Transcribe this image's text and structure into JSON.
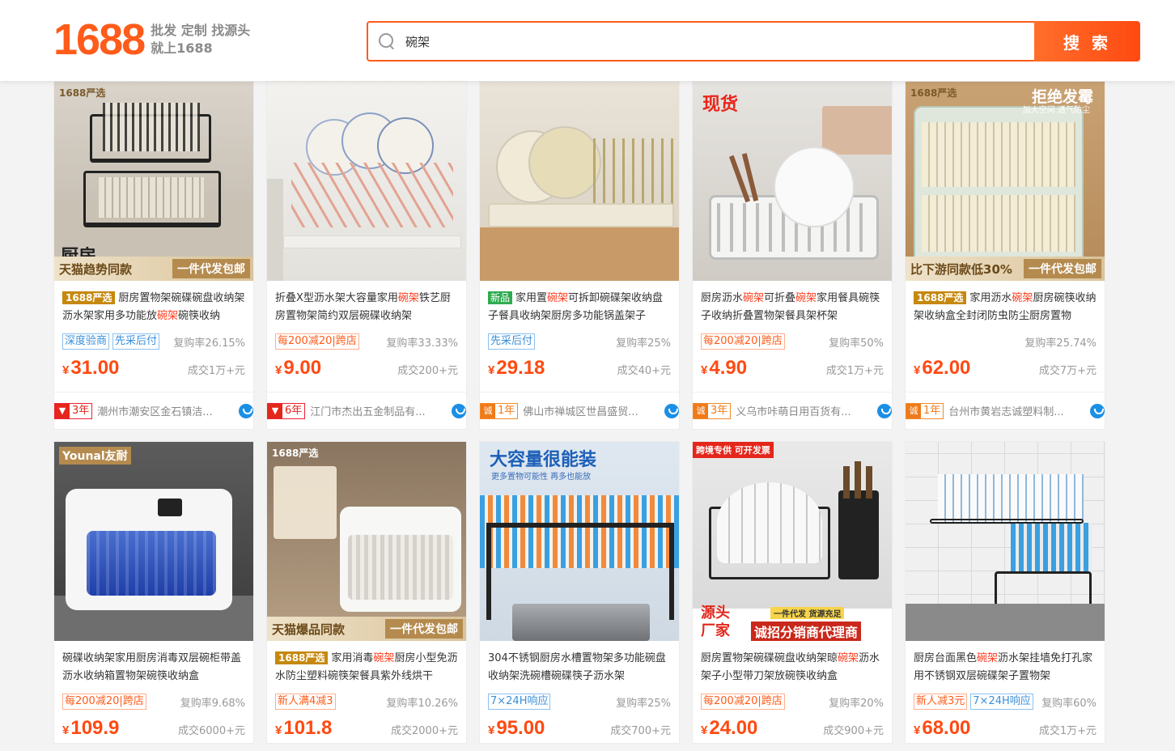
{
  "header": {
    "logo_text": "1688",
    "logo_tag_line1": "批发 定制 找源头",
    "logo_tag_line2": "就上1688",
    "search_value": "碗架",
    "search_button": "搜 索"
  },
  "colors": {
    "accent": "#ff5b1a",
    "price": "#ff4a12",
    "yanxuan": "#c6880e",
    "new": "#2eac50"
  },
  "products": [
    {
      "img": {
        "top_tag": "1688严选",
        "banner_left": "天猫趋势同款",
        "banner_right": "一件代发包邮"
      },
      "badge": "1688严选",
      "badge_type": "yx",
      "title_parts": [
        "厨房置物架碗碟碗盘收纳架沥水架家用多功能放",
        "碗架",
        "碗筷收纳"
      ],
      "tags": [
        {
          "text": "深度验商",
          "color": "blue"
        },
        {
          "text": "先采后付",
          "color": "blue"
        }
      ],
      "rebuy": "复购率26.15%",
      "price": "31.00",
      "deal": "成交1万+元",
      "shop_badge": "tm",
      "shop_years": "3年",
      "shop": "潮州市潮安区金石镇洁..."
    },
    {
      "img": {},
      "badge": "",
      "badge_type": "",
      "title_parts": [
        "折叠X型沥水架大容量家用",
        "碗架",
        "铁艺厨房置物架简约双层碗碟收纳架"
      ],
      "tags": [
        {
          "text": "每200减20|跨店",
          "color": "orange"
        }
      ],
      "rebuy": "复购率33.33%",
      "price": "9.00",
      "deal": "成交200+元",
      "shop_badge": "tm",
      "shop_years": "6年",
      "shop": "江门市杰出五金制品有..."
    },
    {
      "img": {},
      "badge": "新品",
      "badge_type": "new",
      "title_parts": [
        "家用置",
        "碗架",
        "可拆卸碗碟架收纳盘子餐具收纳架厨房多功能锅盖架子"
      ],
      "tags": [
        {
          "text": "先采后付",
          "color": "blue"
        }
      ],
      "rebuy": "复购率25%",
      "price": "29.18",
      "deal": "成交40+元",
      "shop_badge": "cx",
      "shop_years": "1年",
      "shop": "佛山市禅城区世昌盛贸..."
    },
    {
      "img": {
        "top_tag": "现货"
      },
      "badge": "",
      "badge_type": "",
      "title_parts": [
        "厨房沥水",
        "碗架",
        "可折叠",
        "碗架",
        "家用餐具碗筷子收纳折叠置物架餐具架杯架"
      ],
      "tags": [
        {
          "text": "每200减20|跨店",
          "color": "orange"
        }
      ],
      "rebuy": "复购率50%",
      "price": "4.90",
      "deal": "成交1万+元",
      "shop_badge": "cx",
      "shop_years": "3年",
      "shop": "义乌市咔萌日用百货有..."
    },
    {
      "img": {
        "top_tag": "1688严选",
        "top_right": "拒绝发霉",
        "top_right_sub": "加大空间 透气防尘",
        "banner_left": "比下游同款低30%",
        "banner_right": "一件代发包邮"
      },
      "badge": "1688严选",
      "badge_type": "yx",
      "title_parts": [
        "家用沥水",
        "碗架",
        "厨房碗筷收纳架收纳盒全封闭防虫防尘厨房置物"
      ],
      "tags": [],
      "rebuy": "复购率25.74%",
      "price": "62.00",
      "deal": "成交7万+元",
      "shop_badge": "cx",
      "shop_years": "1年",
      "shop": "台州市黄岩志诚塑料制..."
    },
    {
      "img": {
        "top_tag": "Younal友耐"
      },
      "badge": "",
      "badge_type": "",
      "title_parts": [
        "碗碟收纳架家用厨房消毒双层碗柜带盖沥水收纳箱置物架碗筷收纳盒"
      ],
      "tags": [
        {
          "text": "每200减20|跨店",
          "color": "orange"
        }
      ],
      "rebuy": "复购率9.68%",
      "price": "109.9",
      "deal": "成交6000+元"
    },
    {
      "img": {
        "top_tag": "1688严选",
        "banner_left": "天猫爆品同款",
        "banner_right": "一件代发包邮"
      },
      "badge": "1688严选",
      "badge_type": "yx",
      "title_parts": [
        "家用消毒",
        "碗架",
        "厨房小型免沥水防尘塑料碗筷架餐具紫外线烘干"
      ],
      "tags": [
        {
          "text": "新人满4减3",
          "color": "orange"
        }
      ],
      "rebuy": "复购率10.26%",
      "price": "101.8",
      "deal": "成交2000+元"
    },
    {
      "img": {
        "top_title": "大容量很能装",
        "top_sub": "更多置物可能性 再多也能放"
      },
      "badge": "",
      "badge_type": "",
      "title_parts": [
        "304不锈钢厨房水槽置物架多功能碗盘收纳架洗碗槽碗碟筷子沥水架"
      ],
      "tags": [
        {
          "text": "7×24H响应",
          "color": "blue"
        }
      ],
      "rebuy": "复购率25%",
      "price": "95.00",
      "deal": "成交700+元"
    },
    {
      "img": {
        "top_tag": "跨境专供 可开发票",
        "banner_big_1": "源头",
        "banner_big_2": "厂家",
        "banner_small": "一件代发 货源充足",
        "banner_right": "诚招分销商代理商"
      },
      "badge": "",
      "badge_type": "",
      "title_parts": [
        "厨房置物架碗碟碗盘收纳架晾",
        "碗架",
        "沥水架子小型带刀架放碗筷收纳盒"
      ],
      "tags": [
        {
          "text": "每200减20|跨店",
          "color": "orange"
        }
      ],
      "rebuy": "复购率20%",
      "price": "24.00",
      "deal": "成交900+元"
    },
    {
      "img": {},
      "badge": "",
      "badge_type": "",
      "title_parts": [
        "厨房台面黑色",
        "碗架",
        "沥水架挂墙免打孔家用不锈钢双层碗碟架子置物架"
      ],
      "tags": [
        {
          "text": "新人减3元",
          "color": "orange"
        },
        {
          "text": "7×24H响应",
          "color": "blue"
        }
      ],
      "rebuy": "复购率60%",
      "price": "68.00",
      "deal": "成交1万+元"
    }
  ]
}
